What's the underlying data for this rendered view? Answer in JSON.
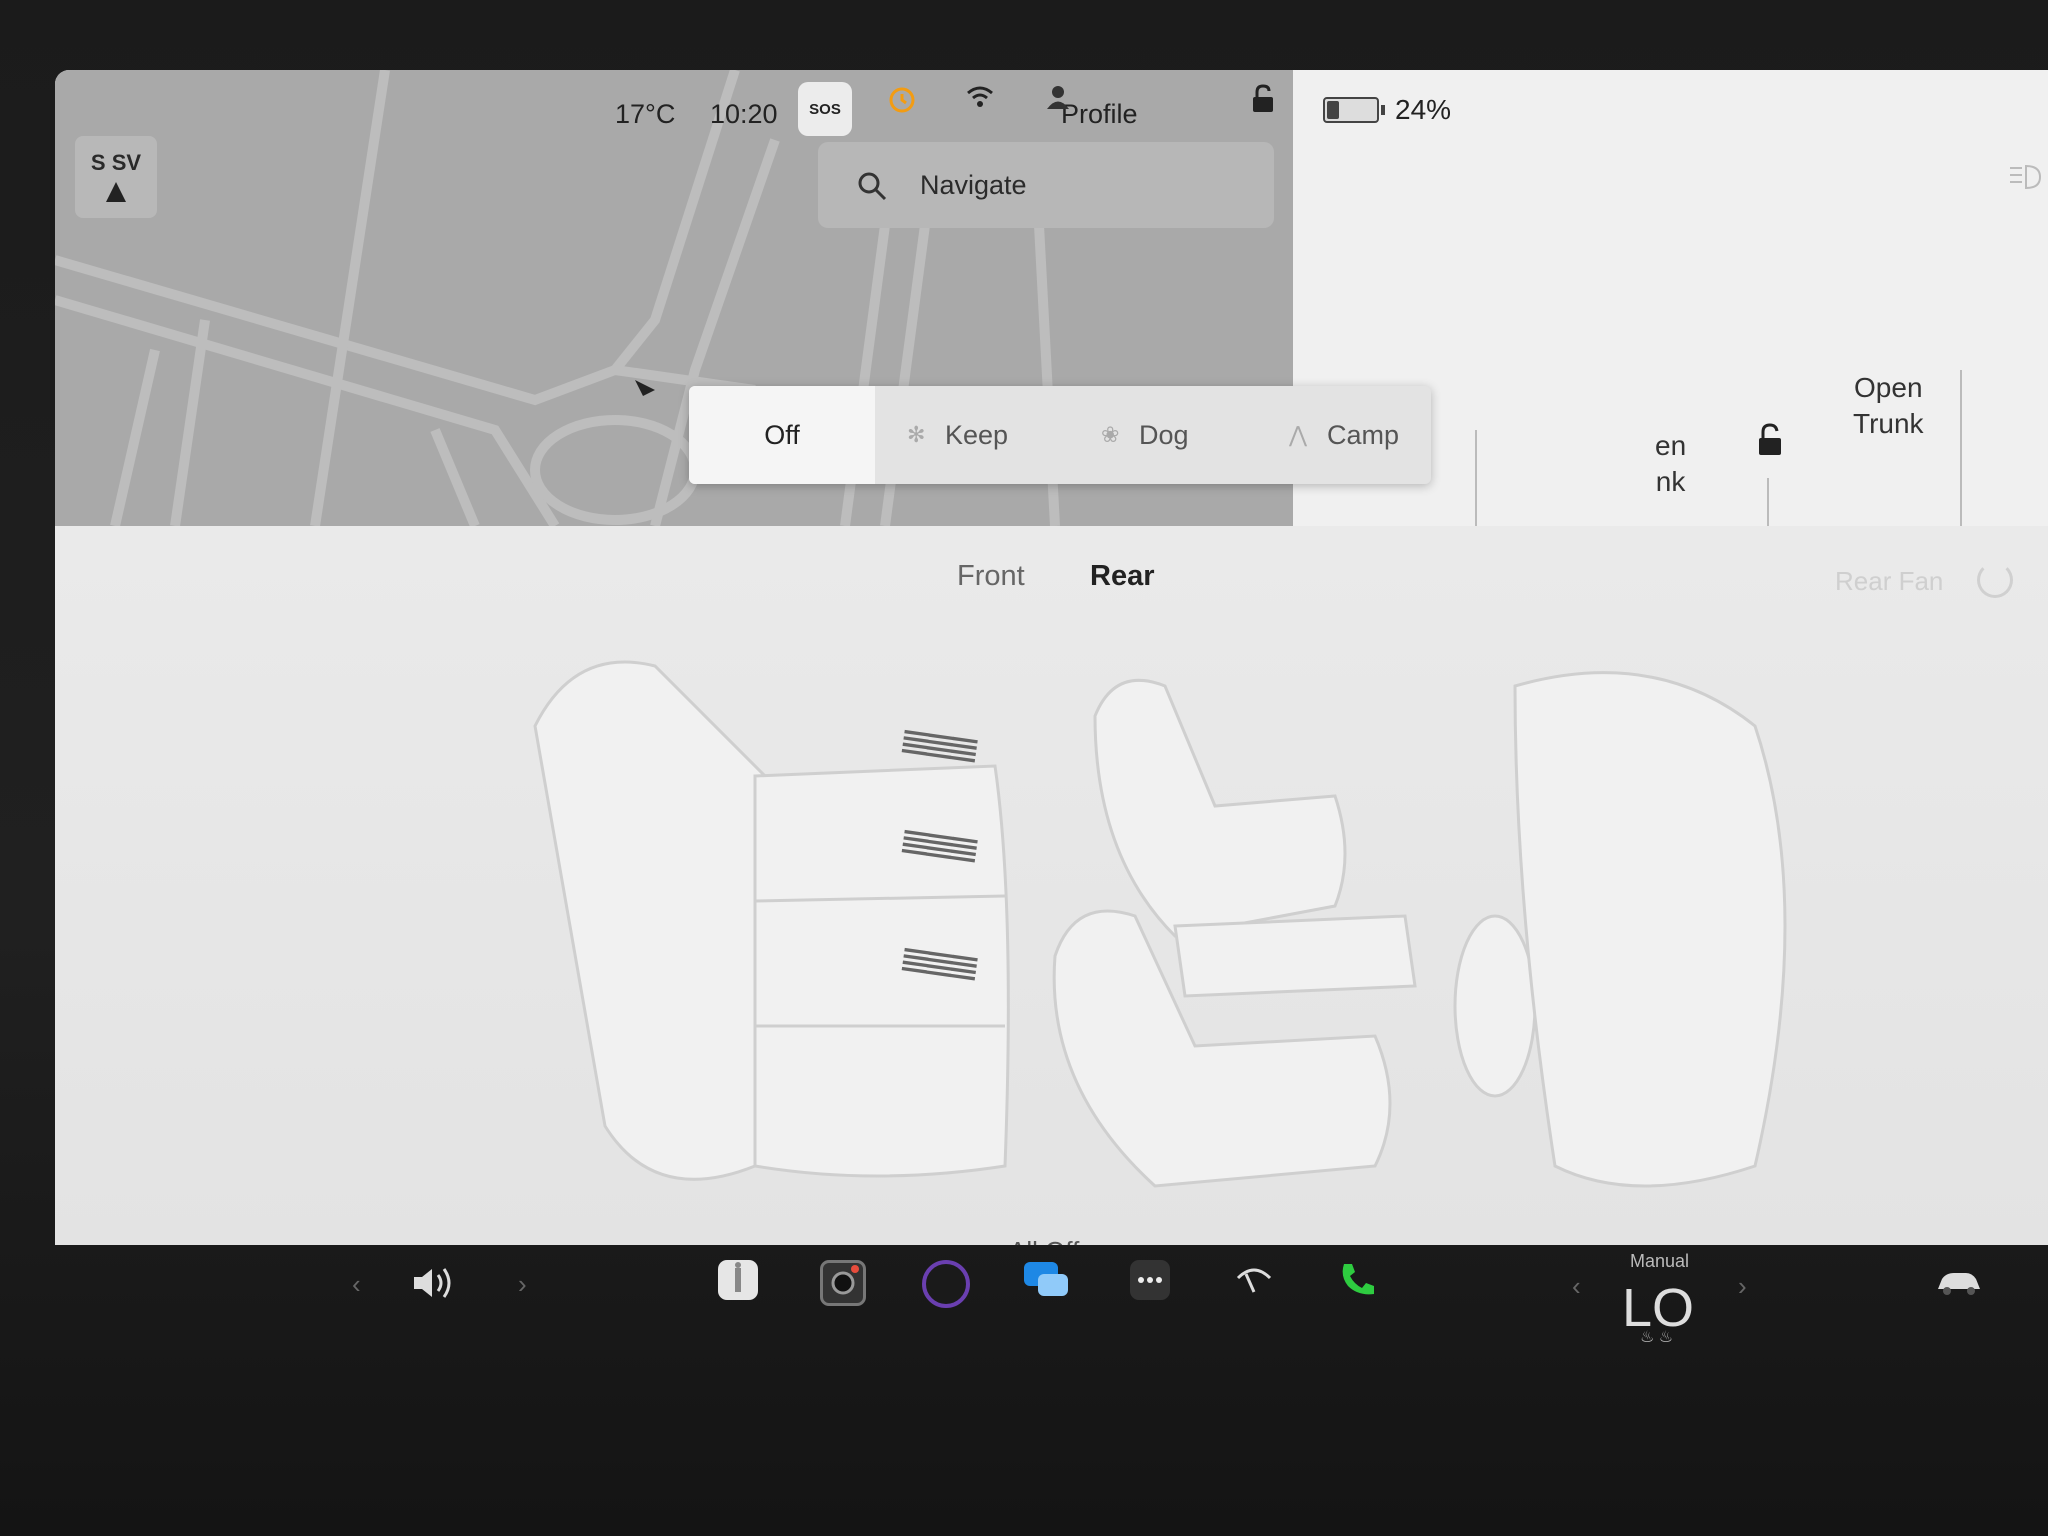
{
  "status_bar": {
    "temperature": "17°C",
    "time": "10:20",
    "sos_label": "SOS",
    "profile_label": "Profile",
    "battery_percent": "24%",
    "battery_level": 0.24
  },
  "compass": {
    "heading": "S SV"
  },
  "search": {
    "placeholder": "Navigate"
  },
  "trunk": {
    "front_partial_line1": "en",
    "front_partial_line2": "nk",
    "rear_line1": "Open",
    "rear_line2": "Trunk"
  },
  "climate_modes": {
    "off": "Off",
    "keep": "Keep",
    "dog": "Dog",
    "camp": "Camp",
    "selected": "Off"
  },
  "climate_tabs": {
    "front": "Front",
    "rear": "Rear",
    "selected": "Rear"
  },
  "rear_fan": {
    "label": "Rear Fan"
  },
  "seat_heat": {
    "all_off_label": "All Off"
  },
  "taskbar": {
    "manual_label": "Manual",
    "temperature_value": "LO"
  },
  "colors": {
    "accent_orange": "#f39c12",
    "phone_green": "#2ecc40",
    "messages_blue": "#1e88e5"
  }
}
